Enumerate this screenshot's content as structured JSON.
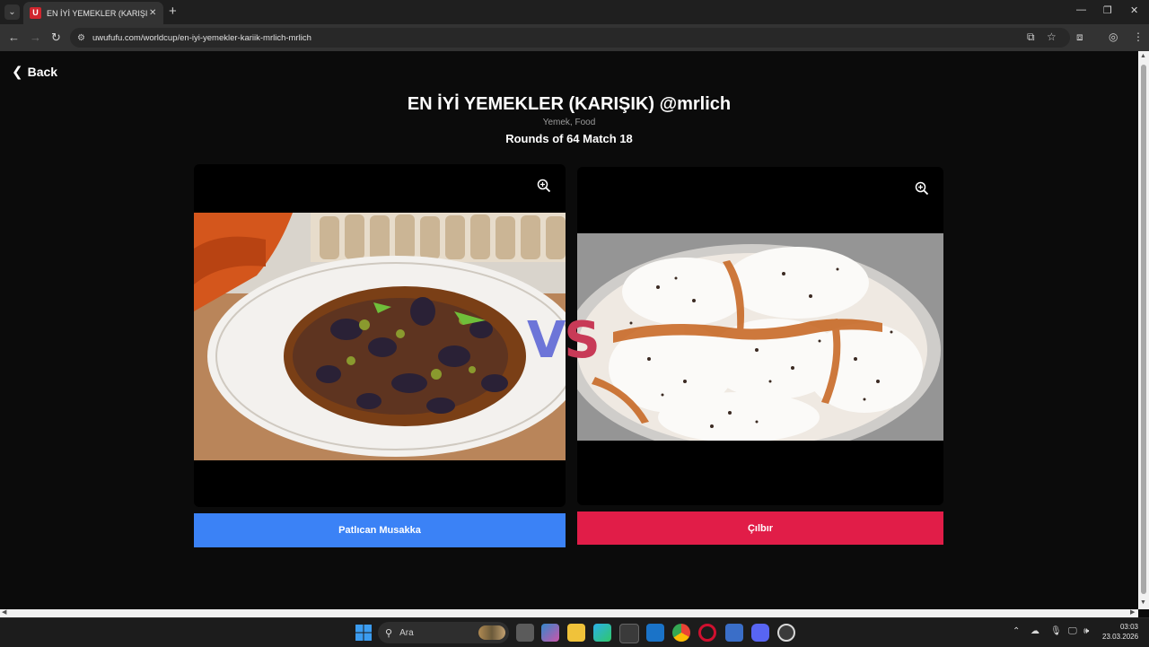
{
  "browser": {
    "tab_title": "EN İYİ YEMEKLER (KARIŞIK) @mrlich",
    "tab_favicon": "U",
    "url": "uwufufu.com/worldcup/en-iyi-yemekler-kariik-mrlich-mrlich"
  },
  "page": {
    "back_label": "Back",
    "title": "EN İYİ YEMEKLER (KARIŞIK) @mrlich",
    "category": "Yemek, Food",
    "round": "Rounds of 64 Match 18",
    "vs_v": "V",
    "vs_s": "S",
    "left_choice": "Patlıcan Musakka",
    "right_choice": "Çılbır"
  },
  "taskbar": {
    "search_label": "Ara",
    "time": "03:03",
    "date": "23.03.2026"
  },
  "colors": {
    "left_button": "#3b82f6",
    "right_button": "#e11d48",
    "vs_v": "#6d75d8",
    "vs_s": "#c83a57"
  }
}
